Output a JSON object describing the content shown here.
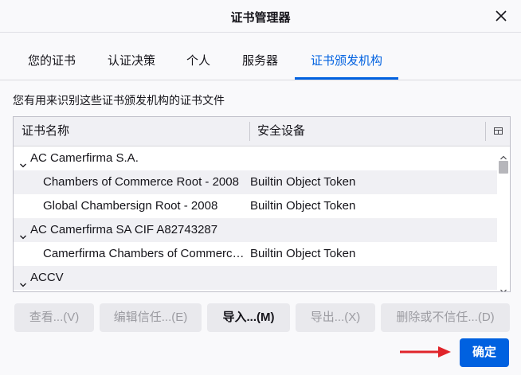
{
  "dialog": {
    "title": "证书管理器",
    "close_icon": "close-icon"
  },
  "tabs": [
    {
      "label": "您的证书",
      "active": false
    },
    {
      "label": "认证决策",
      "active": false
    },
    {
      "label": "个人",
      "active": false
    },
    {
      "label": "服务器",
      "active": false
    },
    {
      "label": "证书颁发机构",
      "active": true
    }
  ],
  "description": "您有用来识别这些证书颁发机构的证书文件",
  "tree": {
    "columns": [
      {
        "label": "证书名称"
      },
      {
        "label": "安全设备"
      }
    ],
    "rows": [
      {
        "name": "AC Camerfirma S.A.",
        "device": "",
        "group": true
      },
      {
        "name": "Chambers of Commerce Root - 2008",
        "device": "Builtin Object Token",
        "group": false
      },
      {
        "name": "Global Chambersign Root - 2008",
        "device": "Builtin Object Token",
        "group": false
      },
      {
        "name": "AC Camerfirma SA CIF A82743287",
        "device": "",
        "group": true
      },
      {
        "name": "Camerfirma Chambers of Commerce Root",
        "device": "Builtin Object Token",
        "group": false
      },
      {
        "name": "ACCV",
        "device": "",
        "group": true
      }
    ]
  },
  "buttons": {
    "view": "查看...(V)",
    "edit_trust": "编辑信任...(E)",
    "import": "导入...(M)",
    "export": "导出...(X)",
    "delete": "删除或不信任...(D)",
    "ok": "确定"
  },
  "colors": {
    "accent": "#0061e0",
    "arrow": "#e0242a"
  }
}
